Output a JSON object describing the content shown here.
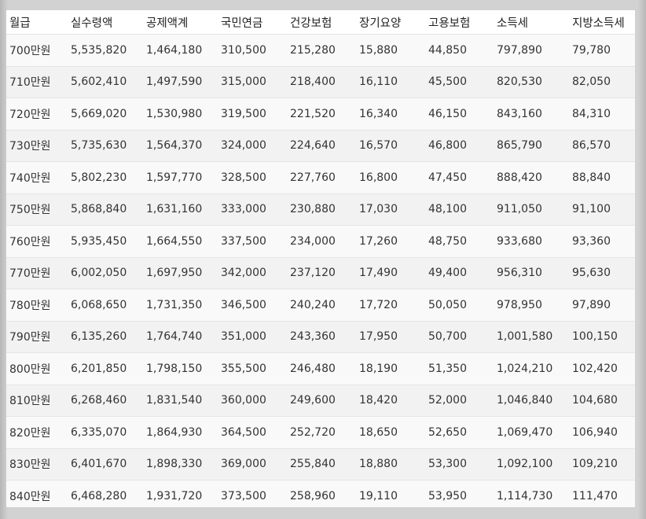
{
  "table": {
    "headers": [
      "월급",
      "실수령액",
      "공제액계",
      "국민연금",
      "건강보험",
      "장기요양",
      "고용보험",
      "소득세",
      "지방소득세"
    ],
    "rows": [
      [
        "700만원",
        "5,535,820",
        "1,464,180",
        "310,500",
        "215,280",
        "15,880",
        "44,850",
        "797,890",
        "79,780"
      ],
      [
        "710만원",
        "5,602,410",
        "1,497,590",
        "315,000",
        "218,400",
        "16,110",
        "45,500",
        "820,530",
        "82,050"
      ],
      [
        "720만원",
        "5,669,020",
        "1,530,980",
        "319,500",
        "221,520",
        "16,340",
        "46,150",
        "843,160",
        "84,310"
      ],
      [
        "730만원",
        "5,735,630",
        "1,564,370",
        "324,000",
        "224,640",
        "16,570",
        "46,800",
        "865,790",
        "86,570"
      ],
      [
        "740만원",
        "5,802,230",
        "1,597,770",
        "328,500",
        "227,760",
        "16,800",
        "47,450",
        "888,420",
        "88,840"
      ],
      [
        "750만원",
        "5,868,840",
        "1,631,160",
        "333,000",
        "230,880",
        "17,030",
        "48,100",
        "911,050",
        "91,100"
      ],
      [
        "760만원",
        "5,935,450",
        "1,664,550",
        "337,500",
        "234,000",
        "17,260",
        "48,750",
        "933,680",
        "93,360"
      ],
      [
        "770만원",
        "6,002,050",
        "1,697,950",
        "342,000",
        "237,120",
        "17,490",
        "49,400",
        "956,310",
        "95,630"
      ],
      [
        "780만원",
        "6,068,650",
        "1,731,350",
        "346,500",
        "240,240",
        "17,720",
        "50,050",
        "978,950",
        "97,890"
      ],
      [
        "790만원",
        "6,135,260",
        "1,764,740",
        "351,000",
        "243,360",
        "17,950",
        "50,700",
        "1,001,580",
        "100,150"
      ],
      [
        "800만원",
        "6,201,850",
        "1,798,150",
        "355,500",
        "246,480",
        "18,190",
        "51,350",
        "1,024,210",
        "102,420"
      ],
      [
        "810만원",
        "6,268,460",
        "1,831,540",
        "360,000",
        "249,600",
        "18,420",
        "52,000",
        "1,046,840",
        "104,680"
      ],
      [
        "820만원",
        "6,335,070",
        "1,864,930",
        "364,500",
        "252,720",
        "18,650",
        "52,650",
        "1,069,470",
        "106,940"
      ],
      [
        "830만원",
        "6,401,670",
        "1,898,330",
        "369,000",
        "255,840",
        "18,880",
        "53,300",
        "1,092,100",
        "109,210"
      ],
      [
        "840만원",
        "6,468,280",
        "1,931,720",
        "373,500",
        "258,960",
        "19,110",
        "53,950",
        "1,114,730",
        "111,470"
      ]
    ]
  }
}
